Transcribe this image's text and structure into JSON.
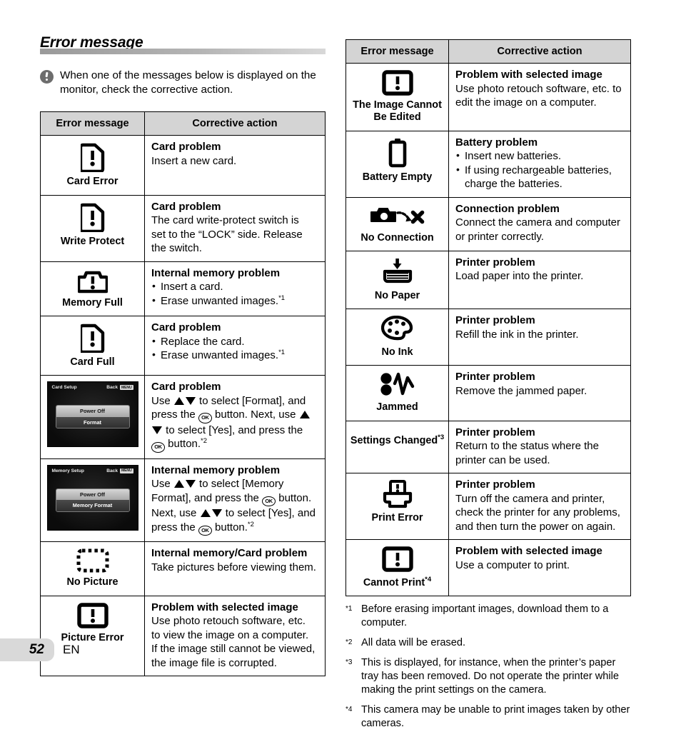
{
  "section": {
    "title": "Error message",
    "note": "When one of the messages below is displayed on the monitor, check the corrective action.",
    "note_icon": "exclamation-circle-icon"
  },
  "table_headers": {
    "message": "Error message",
    "action": "Corrective action"
  },
  "left_table": {
    "rows": [
      {
        "icon": "sd-card-exclamation-icon",
        "label": "Card Error",
        "action_title": "Card problem",
        "action_lines": [
          "Insert a new card."
        ],
        "bullets": []
      },
      {
        "icon": "sd-card-exclamation-icon",
        "label": "Write Protect",
        "action_title": "Card problem",
        "action_lines": [
          "The card write-protect switch is",
          "set to the “LOCK” side. Release",
          "the switch."
        ],
        "bullets": []
      },
      {
        "icon": "camera-exclamation-icon",
        "label": "Memory Full",
        "action_title": "Internal memory problem",
        "action_lines": [],
        "bullets": [
          "Insert a card.",
          "Erase unwanted images."
        ],
        "bullet_footnotes": [
          "",
          "*1"
        ]
      },
      {
        "icon": "sd-card-exclamation-icon",
        "label": "Card Full",
        "action_title": "Card problem",
        "action_lines": [],
        "bullets": [
          "Replace the card.",
          "Erase unwanted images."
        ],
        "bullet_footnotes": [
          "",
          "*1"
        ]
      },
      {
        "icon": "lcd-card-setup-screen",
        "label": "",
        "action_title": "Card problem",
        "action_lines": [],
        "bullets": [],
        "screen": {
          "title": "Card Setup",
          "back_label": "Back",
          "menu_key": "MENU",
          "options": [
            "Power Off",
            "Format"
          ],
          "selected_index": 0
        }
      },
      {
        "icon": "lcd-memory-setup-screen",
        "label": "",
        "action_title": "Internal memory problem",
        "action_lines": [],
        "bullets": [],
        "screen": {
          "title": "Memory Setup",
          "back_label": "Back",
          "menu_key": "MENU",
          "options": [
            "Power Off",
            "Memory Format"
          ],
          "selected_index": 0
        }
      },
      {
        "icon": "dashed-rectangle-icon",
        "label": "No Picture",
        "action_title": "Internal memory/Card problem",
        "action_lines": [
          "Take pictures before viewing them."
        ],
        "bullets": []
      },
      {
        "icon": "framed-exclamation-icon",
        "label": "Picture Error",
        "action_title": "Problem with selected image",
        "action_lines": [
          "Use photo retouch software, etc.",
          "to view the image on a computer.",
          "If the image still cannot be viewed,",
          "the image file is corrupted."
        ],
        "bullets": []
      }
    ],
    "format_instruction": {
      "prefix": "Use",
      "mid1": "to select [Format], and",
      "mid2": "press the",
      "mid3": "button. Next, use",
      "mid4": "to select [Yes], and press the",
      "mid5": "button.",
      "footnote": "*2",
      "ok_label": "OK"
    },
    "memory_format_instruction": {
      "prefix": "Use",
      "mid1": "to select [Memory",
      "mid2": "Format], and press the",
      "mid3": "button.",
      "mid4": "Next, use",
      "mid5": "to select [Yes], and",
      "mid6": "press the",
      "mid7": "button.",
      "footnote": "*2",
      "ok_label": "OK"
    }
  },
  "right_table": {
    "rows": [
      {
        "icon": "framed-exclamation-icon",
        "label": "The Image Cannot Be Edited",
        "action_title": "Problem with selected image",
        "action_lines": [
          "Use photo retouch software, etc. to",
          "edit the image on a computer."
        ],
        "bullets": []
      },
      {
        "icon": "battery-empty-icon",
        "label": "Battery Empty",
        "action_title": "Battery problem",
        "action_lines": [],
        "bullets": [
          "Insert new batteries.",
          "If using rechargeable batteries, charge the batteries."
        ]
      },
      {
        "icon": "camera-no-connection-icon",
        "label": "No Connection",
        "action_title": "Connection problem",
        "action_lines": [
          "Connect the camera and computer",
          "or printer correctly."
        ],
        "bullets": []
      },
      {
        "icon": "paper-tray-icon",
        "label": "No Paper",
        "action_title": "Printer problem",
        "action_lines": [
          "Load paper into the printer."
        ],
        "bullets": []
      },
      {
        "icon": "palette-icon",
        "label": "No Ink",
        "action_title": "Printer problem",
        "action_lines": [
          "Refill the ink in the printer."
        ],
        "bullets": []
      },
      {
        "icon": "paper-jam-icon",
        "label": "Jammed",
        "action_title": "Printer problem",
        "action_lines": [
          "Remove the jammed paper."
        ],
        "bullets": []
      },
      {
        "icon": "",
        "label": "Settings Changed",
        "label_footnote": "*3",
        "action_title": "Printer problem",
        "action_lines": [
          "Return to the status where the",
          "printer can be used."
        ],
        "bullets": []
      },
      {
        "icon": "printer-error-icon",
        "label": "Print Error",
        "action_title": "Printer problem",
        "action_lines": [
          "Turn off the camera and printer,",
          "check the printer for any problems,",
          "and then turn the power on again."
        ],
        "bullets": []
      },
      {
        "icon": "framed-exclamation-icon",
        "label": "Cannot Print",
        "label_footnote": "*4",
        "action_title": "Problem with selected image",
        "action_lines": [
          "Use a computer to print."
        ],
        "bullets": []
      }
    ]
  },
  "footnotes": [
    {
      "mark": "*1",
      "text": "Before erasing important images, download them to a computer."
    },
    {
      "mark": "*2",
      "text": "All data will be erased."
    },
    {
      "mark": "*3",
      "text": "This is displayed, for instance, when the printer’s paper tray has been removed. Do not operate the printer while making the print settings on the camera."
    },
    {
      "mark": "*4",
      "text": "This camera may be unable to print images taken by other cameras."
    }
  ],
  "footer": {
    "page_number": "52",
    "language": "EN"
  },
  "colors": {
    "header_fill": "#d4d4d4",
    "rule_dark": "#9a9a9a",
    "rule_light": "#d8d8d8",
    "page_box": "#d9d9d9"
  }
}
